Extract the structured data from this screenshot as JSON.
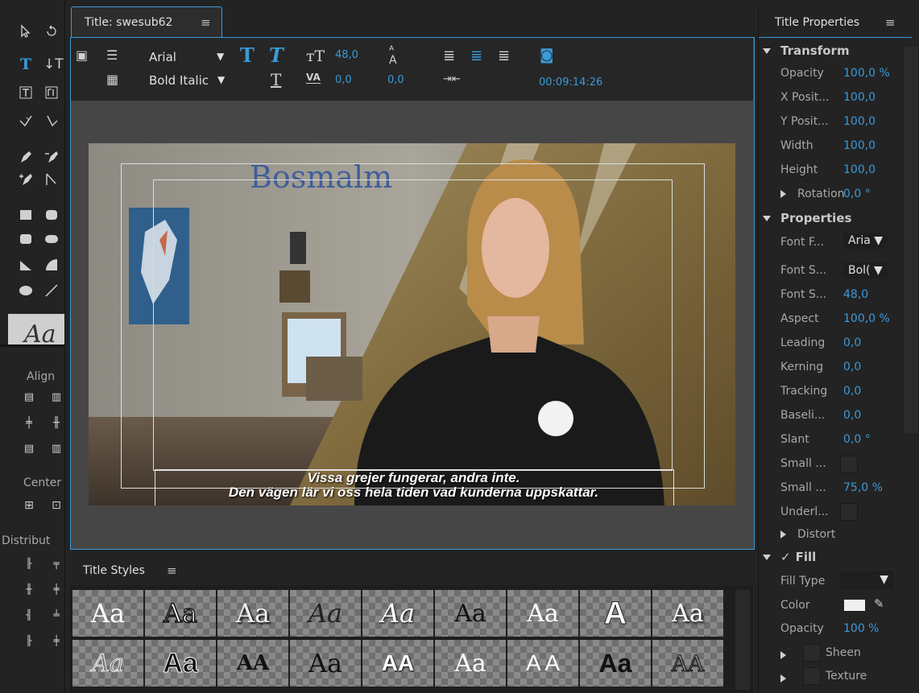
{
  "title_panel": {
    "tab_label": "Title: swesub62",
    "menu_icon": "≡",
    "font_family": "Arial",
    "font_style": "Bold Italic",
    "font_size": "48,0",
    "kerning": "0,0",
    "leading": "0,0",
    "timecode": "00:09:14:26"
  },
  "video": {
    "sign_text": "Bosmalm",
    "subtitle_line1": "Vissa grejer fungerar, andra inte.",
    "subtitle_line2": "Den vägen lär vi oss hela tiden vad kunderna uppskattar."
  },
  "tools": {
    "align_label": "Align",
    "center_label": "Center",
    "distribute_label": "Distribut",
    "style_preview": "Aa"
  },
  "styles": {
    "header": "Title Styles",
    "menu_icon": "≡",
    "swatches_row1": [
      "Aa",
      "Aa",
      "Aa",
      "Aa",
      "Aa",
      "Aa",
      "Aa",
      "A",
      "Aa"
    ],
    "swatches_row2": [
      "Aa",
      "Aa",
      "AA",
      "Aa",
      "AA",
      "Aa",
      "A A",
      "Aa",
      "AA"
    ]
  },
  "properties": {
    "header": "Title Properties",
    "menu_icon": "≡",
    "transform": {
      "label": "Transform",
      "opacity_label": "Opacity",
      "opacity": "100,0 %",
      "xpos_label": "X Posit...",
      "xpos": "100,0",
      "ypos_label": "Y Posit...",
      "ypos": "100,0",
      "width_label": "Width",
      "width": "100,0",
      "height_label": "Height",
      "height": "100,0",
      "rotation_label": "Rotation",
      "rotation": "0,0 °"
    },
    "props": {
      "label": "Properties",
      "font_family_label": "Font F...",
      "font_family": "Aria",
      "font_style_label": "Font S...",
      "font_style": "Bol(",
      "font_size_label": "Font S...",
      "font_size": "48,0",
      "aspect_label": "Aspect",
      "aspect": "100,0 %",
      "leading_label": "Leading",
      "leading": "0,0",
      "kerning_label": "Kerning",
      "kerning": "0,0",
      "tracking_label": "Tracking",
      "tracking": "0,0",
      "baseline_label": "Baseli...",
      "baseline": "0,0",
      "slant_label": "Slant",
      "slant": "0,0 °",
      "smallcaps_label": "Small ...",
      "smallcaps_size_label": "Small ...",
      "smallcaps_size": "75,0 %",
      "underline_label": "Underl...",
      "distort_label": "Distort"
    },
    "fill": {
      "label": "Fill",
      "fill_type_label": "Fill Type",
      "color_label": "Color",
      "opacity_label": "Opacity",
      "opacity": "100 %",
      "sheen_label": "Sheen",
      "texture_label": "Texture"
    }
  }
}
